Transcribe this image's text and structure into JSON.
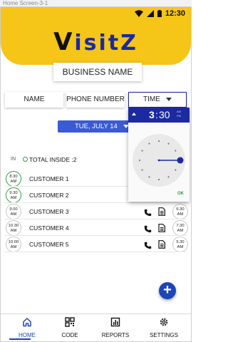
{
  "frame_title": "Home Screen-3-1",
  "status_bar": {
    "time": "12:30"
  },
  "app": {
    "logo_first": "V",
    "logo_rest": "isitZ"
  },
  "business_name": "BUSINESS NAME",
  "columns": {
    "name": "NAME",
    "phone": "PHONE NUMBER",
    "time": "TIME"
  },
  "date_selector": {
    "value": "TUE, JULY 14"
  },
  "summary": {
    "in_label": "IN",
    "total_inside": "TOTAL INSIDE :2"
  },
  "customers": [
    {
      "in_time": "8.30",
      "in_period": "AM",
      "name": "CUSTOMER 1",
      "inside": true,
      "out_time": "",
      "out_period": ""
    },
    {
      "in_time": "9.30",
      "in_period": "AM",
      "name": "CUSTOMER 2",
      "inside": true,
      "out_time": "",
      "out_period": ""
    },
    {
      "in_time": "9.00",
      "in_period": "AM",
      "name": "CUSTOMER 3",
      "inside": false,
      "out_time": "6.30",
      "out_period": "AM"
    },
    {
      "in_time": "10.30",
      "in_period": "AM",
      "name": "CUSTOMER 4",
      "inside": false,
      "out_time": "7.30",
      "out_period": "AM"
    },
    {
      "in_time": "10:00",
      "in_period": "AM",
      "name": "CUSTOMER 5",
      "inside": false,
      "out_time": "5.30",
      "out_period": "AM"
    }
  ],
  "time_picker": {
    "hour": "3",
    "minute": "30",
    "am_label": "AM",
    "pm_label": "PM",
    "ok_label": "OK",
    "selected_minute": 30
  },
  "bottom_nav": [
    {
      "label": "HOME",
      "icon": "home-icon",
      "active": true
    },
    {
      "label": "CODE",
      "icon": "qr-code-icon",
      "active": false
    },
    {
      "label": "REPORTS",
      "icon": "reports-icon",
      "active": false
    },
    {
      "label": "SETTINGS",
      "icon": "settings-icon",
      "active": false
    }
  ],
  "fab": {
    "label": "+"
  },
  "colors": {
    "accent_yellow": "#f5c518",
    "primary_blue": "#1c2aa0",
    "date_blue": "#3a5bd3",
    "inside_green": "#2e9e44"
  }
}
